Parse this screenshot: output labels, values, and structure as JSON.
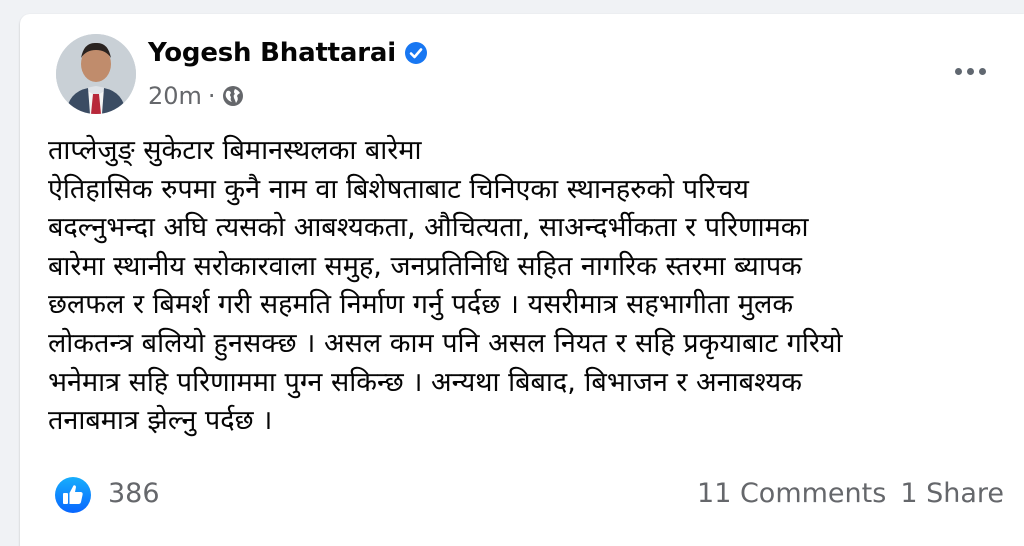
{
  "post": {
    "author": "Yogesh Bhattarai",
    "time": "20m",
    "audience_icon": "globe-icon",
    "body_lines": [
      "ताप्लेजुङ् सुकेटार बिमानस्थलका बारेमा",
      "ए‌ेतिहासिक रुपमा कुनै नाम वा बिशेषताबाट चिनिएका स्थानहरुको परिचय",
      "बदल्नुभन्दा अघि त्यसको आबश्यकता, औचित्यता, साअन्दर्भीकता र परिणामका",
      "बारेमा स्थानीय सरोकारवाला समुह, जनप्रतिनिधि सहित नागरिक स्तरमा ब्यापक",
      "छलफल र बिमर्श गरी सहमति निर्माण गर्नु पर्दछ । यसरीमात्र सहभागीता मुलक",
      "लोकतन्त्र बलियो हुनसक्छ । असल काम पनि असल नियत र सहि प्रकृयाबाट गरियो",
      "भनेमात्र सहि परिणाममा पुग्न सकिन्छ । अन्यथा बिबाद, बिभाजन र अनाबश्यक",
      "तनाबमात्र झेल्नु पर्दछ ।"
    ],
    "reactions_count": "386",
    "comments": "11 Comments",
    "shares": "1 Share"
  },
  "colors": {
    "brand_blue": "#1877f2",
    "secondary_text": "#65676b",
    "card_bg": "#ffffff",
    "page_bg": "#f0f2f5"
  }
}
